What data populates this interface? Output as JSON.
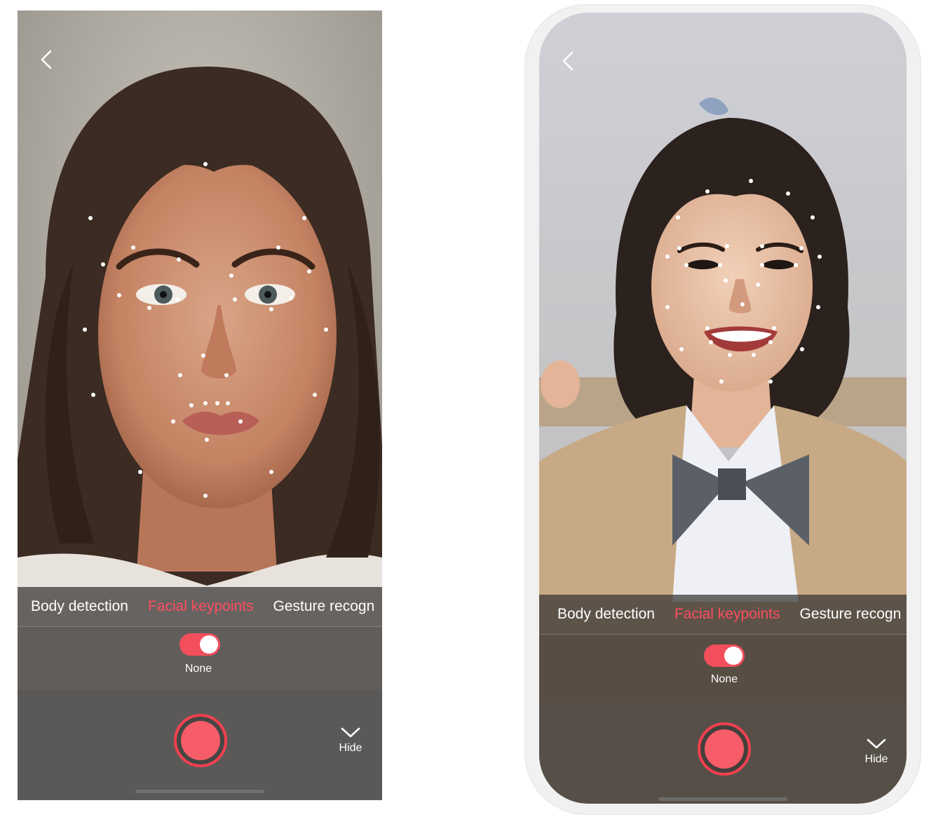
{
  "screens": [
    {
      "tabs": [
        {
          "label": "Body detection",
          "active": false
        },
        {
          "label": "Facial keypoints",
          "active": true
        },
        {
          "label": "Gesture recogn",
          "active": false
        }
      ],
      "toggle": {
        "label": "None",
        "on": true
      },
      "hide_label": "Hide"
    },
    {
      "tabs": [
        {
          "label": "Body detection",
          "active": false
        },
        {
          "label": "Facial keypoints",
          "active": true
        },
        {
          "label": "Gesture recogn",
          "active": false
        }
      ],
      "toggle": {
        "label": "None",
        "on": true
      },
      "hide_label": "Hide"
    }
  ],
  "colors": {
    "accent": "#f34e5c",
    "active_tab": "#ff4e5e",
    "panel": "#343232"
  },
  "icons": [
    "back-chevron-icon",
    "hide-chevron-icon",
    "record-icon"
  ]
}
